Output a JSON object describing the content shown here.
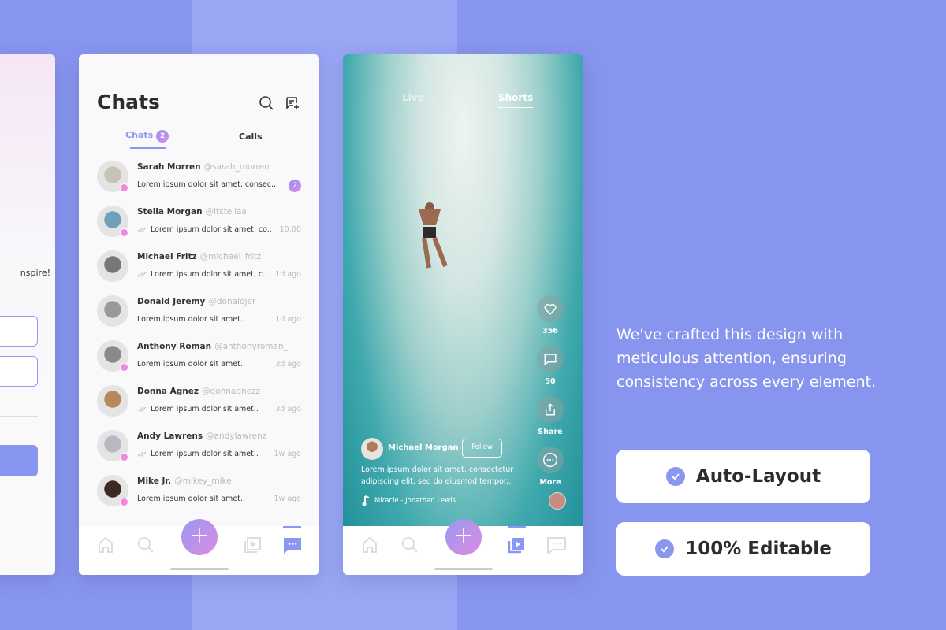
{
  "colors": {
    "background": "#8895ee",
    "accent": "#8b97f2",
    "online": "#f08ae0"
  },
  "left_card": {
    "text": "nspire!"
  },
  "chats": {
    "title": "Chats",
    "icons": [
      "search-icon",
      "new-chat-icon"
    ],
    "tabs": [
      {
        "label": "Chats",
        "badge": "2",
        "active": true
      },
      {
        "label": "Calls"
      }
    ],
    "items": [
      {
        "name": "Sarah Morren",
        "handle": "@sarah_morren",
        "message": "Lorem ipsum dolor sit amet, consec..",
        "unread": "2",
        "online": true,
        "read": false
      },
      {
        "name": "Stella Morgan",
        "handle": "@itstellaa",
        "message": "Lorem ipsum dolor sit amet, co..",
        "time": "10:00",
        "online": true,
        "read": true
      },
      {
        "name": "Michael Fritz",
        "handle": "@michael_fritz",
        "message": "Lorem ipsum dolor sit amet, c..",
        "time": "1d ago",
        "online": false,
        "read": true
      },
      {
        "name": "Donald Jeremy",
        "handle": "@donaldjer",
        "message": "Lorem ipsum dolor sit amet..",
        "time": "1d ago",
        "online": false,
        "read": false
      },
      {
        "name": "Anthony Roman",
        "handle": "@anthonyroman_",
        "message": "Lorem ipsum dolor sit amet..",
        "time": "3d ago",
        "online": true,
        "read": false
      },
      {
        "name": "Donna Agnez",
        "handle": "@donnagnezz",
        "message": "Lorem ipsum dolor sit amet..",
        "time": "3d ago",
        "online": false,
        "read": true
      },
      {
        "name": "Andy Lawrens",
        "handle": "@andylawrenz",
        "message": "Lorem ipsum dolor sit amet..",
        "time": "1w ago",
        "online": true,
        "read": true
      },
      {
        "name": "Mike Jr.",
        "handle": "@mikey_mike",
        "message": "Lorem ipsum dolor sit amet..",
        "time": "1w ago",
        "online": true,
        "read": false
      }
    ],
    "fab": "+"
  },
  "video": {
    "tabs": [
      {
        "label": "Live"
      },
      {
        "label": "Shorts",
        "active": true
      }
    ],
    "likes": "356",
    "comments": "50",
    "share": "Share",
    "more": "More",
    "author": "Michael Morgan",
    "follow": "Follow",
    "caption": "Lorem ipsum dolor sit amet, consectetur adipiscing elit, sed do eiusmod tempor..",
    "music": "Miracle - Jonathan Lewis",
    "fab": "+"
  },
  "marketing": {
    "description": "We've crafted this design with meticulous attention, ensuring consistency across every element.",
    "features": [
      "Auto-Layout",
      "100% Editable"
    ]
  }
}
